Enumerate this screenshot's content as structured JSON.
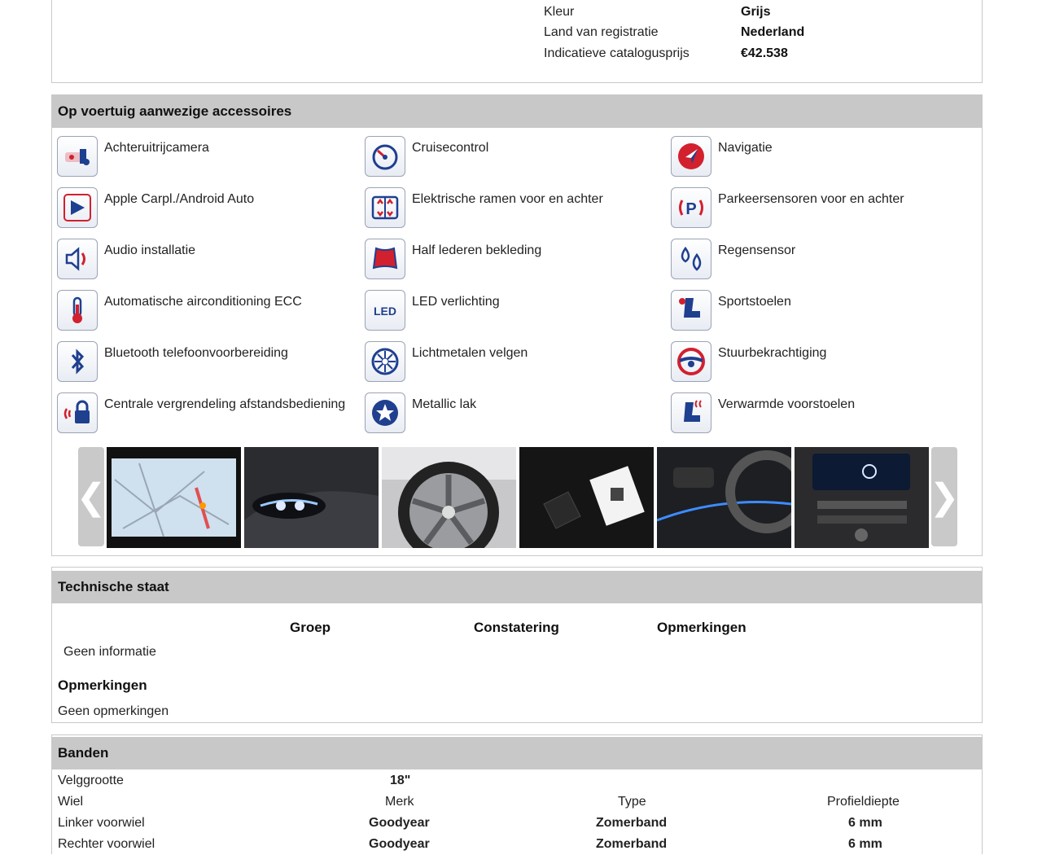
{
  "vehicle_specs": [
    {
      "label": "Kleur",
      "value": "Grijs"
    },
    {
      "label": "Land van registratie",
      "value": "Nederland"
    },
    {
      "label": "Indicatieve catalogusprijs",
      "value": "€42.538"
    }
  ],
  "accessories": {
    "title": "Op voertuig aanwezige accessoires",
    "items": [
      {
        "label": "Achteruitrijcamera",
        "icon": "reverse-camera-icon"
      },
      {
        "label": "Cruisecontrol",
        "icon": "cruise-control-icon"
      },
      {
        "label": "Navigatie",
        "icon": "navigation-icon"
      },
      {
        "label": "Apple Carpl./Android Auto",
        "icon": "carplay-icon"
      },
      {
        "label": "Elektrische ramen voor en achter",
        "icon": "power-windows-icon"
      },
      {
        "label": "Parkeersensoren voor en achter",
        "icon": "parking-sensor-icon"
      },
      {
        "label": "Audio installatie",
        "icon": "speaker-icon"
      },
      {
        "label": "Half lederen bekleding",
        "icon": "leather-icon"
      },
      {
        "label": "Regensensor",
        "icon": "rain-sensor-icon"
      },
      {
        "label": "Automatische airconditioning ECC",
        "icon": "thermometer-icon"
      },
      {
        "label": "LED verlichting",
        "icon": "led-icon"
      },
      {
        "label": "Sportstoelen",
        "icon": "sport-seat-icon"
      },
      {
        "label": "Bluetooth telefoonvoorbereiding",
        "icon": "bluetooth-icon"
      },
      {
        "label": "Lichtmetalen velgen",
        "icon": "alloy-wheel-icon"
      },
      {
        "label": "Stuurbekrachtiging",
        "icon": "steering-wheel-icon"
      },
      {
        "label": "Centrale vergrendeling afstandsbediening",
        "icon": "central-lock-icon"
      },
      {
        "label": "Metallic lak",
        "icon": "metallic-paint-icon"
      },
      {
        "label": "Verwarmde voorstoelen",
        "icon": "heated-seat-icon"
      }
    ],
    "gallery": {
      "prev_icon": "chevron-left-icon",
      "next_icon": "chevron-right-icon",
      "prev_glyph": "❮",
      "next_glyph": "❯",
      "photos": [
        "photo-navigation-screen",
        "photo-headlight",
        "photo-alloy-wheel",
        "photo-keys",
        "photo-door-panel",
        "photo-dashboard-console"
      ]
    }
  },
  "technical": {
    "title": "Technische staat",
    "columns": [
      "Groep",
      "Constatering",
      "Opmerkingen"
    ],
    "empty_text": "Geen informatie",
    "remarks_title": "Opmerkingen",
    "remarks_text": "Geen opmerkingen"
  },
  "tyres": {
    "title": "Banden",
    "rim_label": "Velggrootte",
    "rim_value": "18\"",
    "header": {
      "wheel": "Wiel",
      "brand": "Merk",
      "type": "Type",
      "tread": "Profieldiepte"
    },
    "rows": [
      {
        "wheel": "Linker voorwiel",
        "brand": "Goodyear",
        "type": "Zomerband",
        "tread": "6 mm"
      },
      {
        "wheel": "Rechter voorwiel",
        "brand": "Goodyear",
        "type": "Zomerband",
        "tread": "6 mm"
      }
    ]
  },
  "colors": {
    "header_bg": "#c8c8c8",
    "icon_blue": "#1f3f8f",
    "icon_red": "#d2202f"
  }
}
